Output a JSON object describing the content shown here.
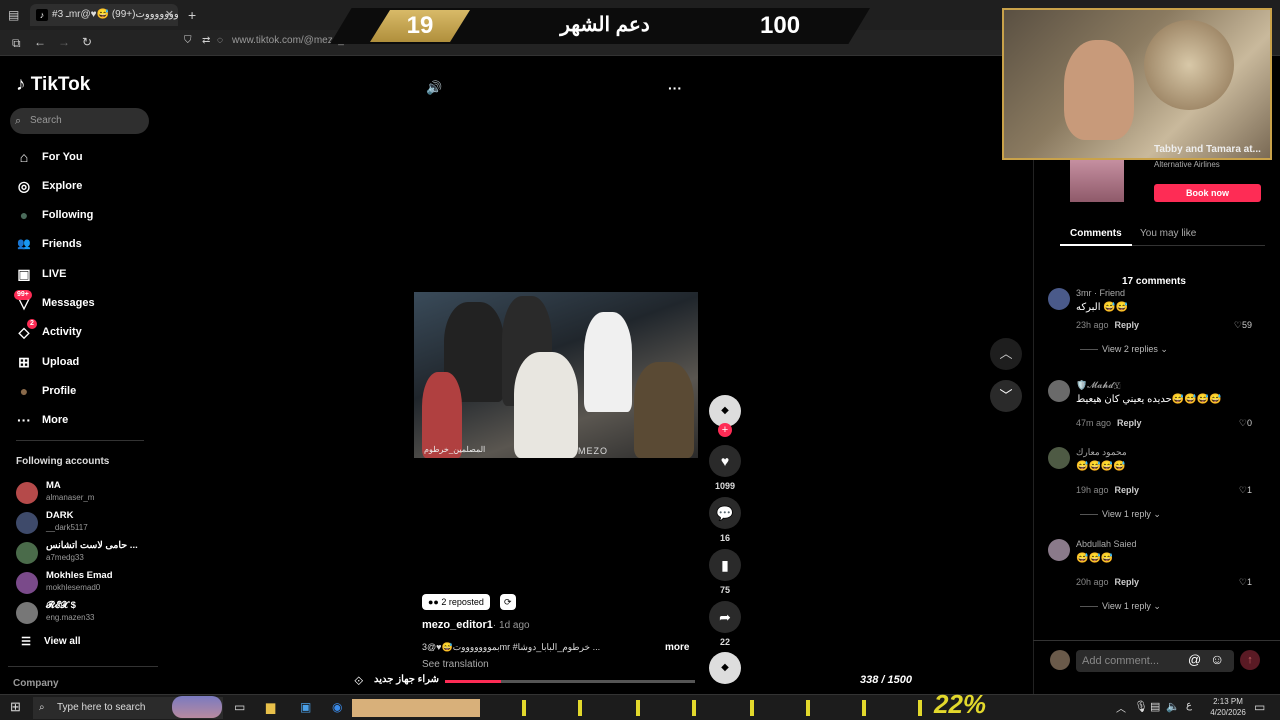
{
  "browser": {
    "tab_title": "#ـ 3mr@♥😅 بموووووووت(+99)",
    "tab_fav": "♪",
    "tab_close": "✕",
    "new_tab": "+",
    "url": "www.tiktok.com/@mezo_e... 4564435220"
  },
  "overlay": {
    "left_number": "19",
    "title": "دعم الشهر",
    "right_number": "100"
  },
  "sidebar": {
    "logo": "TikTok",
    "search_placeholder": "Search",
    "nav": [
      {
        "label": "For You",
        "icon": "⌂"
      },
      {
        "label": "Explore",
        "icon": "◎"
      },
      {
        "label": "Following",
        "icon": "●"
      },
      {
        "label": "Friends",
        "icon": "👥"
      },
      {
        "label": "LIVE",
        "icon": "▣"
      },
      {
        "label": "Messages",
        "icon": "▽",
        "badge": "99+"
      },
      {
        "label": "Activity",
        "icon": "◇",
        "badge": "2"
      },
      {
        "label": "Upload",
        "icon": "⊞"
      },
      {
        "label": "Profile",
        "icon": "●"
      },
      {
        "label": "More",
        "icon": "···"
      }
    ],
    "following_header": "Following accounts",
    "accounts": [
      {
        "name": "MA",
        "user": "almanaser_m"
      },
      {
        "name": "DARK",
        "user": "__dark5117"
      },
      {
        "name": "حامى لاست اتشانس ...",
        "user": "a7medg33"
      },
      {
        "name": "Mokhles Emad",
        "user": "mokhlesemad0"
      },
      {
        "name": "𝓡𝓔𝓧 $",
        "user": "eng.mazen33"
      }
    ],
    "view_all": "View all",
    "company": "Company"
  },
  "video": {
    "watermark": "MEZO",
    "caption_on_video": "المصلمين_خرطوم",
    "volume_icon": "🔊",
    "more_icon": "···"
  },
  "actions": {
    "likes": "1099",
    "comments": "16",
    "saves": "75",
    "shares": "22"
  },
  "post": {
    "reposted": "2 reposted",
    "author": "mezo_editor1",
    "time": "· 1d ago",
    "description": "بموووووووت😅♥@3mr #خرطوم_البابا_دوشا ...",
    "more": "more",
    "see_translation": "See translation"
  },
  "ad": {
    "title": "Tabby and Tamara at...",
    "subtitle": "Alternative Airlines",
    "button": "Book now"
  },
  "panel": {
    "tab_comments": "Comments",
    "tab_may_like": "You may like",
    "count": "17 comments",
    "add_comment": "Add comment..."
  },
  "comments": [
    {
      "name": "3mr · Friend",
      "text": "البركه 😅😅",
      "time": "23h ago",
      "reply": "Reply",
      "likes": "59",
      "view_replies": "View 2 replies ⌄"
    },
    {
      "name": "🛡️𝓜𝓪𝓱𝓭🇾",
      "text": "حديده يعيني كان هيعيط😅😅😅😅",
      "time": "47m ago",
      "reply": "Reply",
      "likes": "0",
      "view_replies": ""
    },
    {
      "name": "محمود معارك",
      "text": "😅😅😅😅",
      "time": "19h ago",
      "reply": "Reply",
      "likes": "1",
      "view_replies": "View 1 reply ⌄"
    },
    {
      "name": "Abdullah Saied",
      "text": "😅😅😅",
      "time": "20h ago",
      "reply": "Reply",
      "likes": "1",
      "view_replies": "View 1 reply ⌄"
    }
  ],
  "stream_bar": {
    "label": "شراء جهاز جديد",
    "progress": "338 / 1500",
    "progress_value": 0.225,
    "percent": "22%"
  },
  "taskbar": {
    "search_placeholder": "Type here to search",
    "time": "2:13 PM",
    "date": "4/20/2026"
  }
}
